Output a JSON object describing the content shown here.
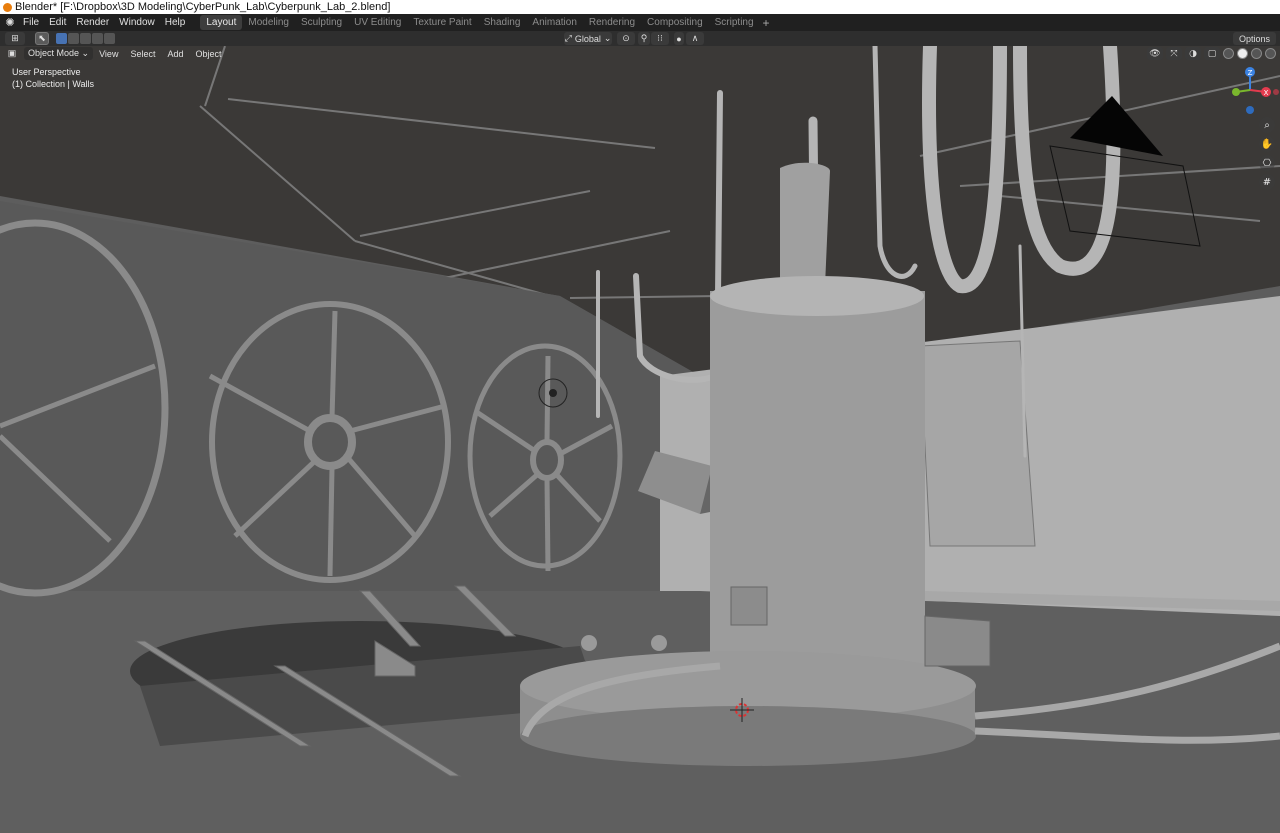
{
  "window": {
    "title": "Blender* [F:\\Dropbox\\3D Modeling\\CyberPunk_Lab\\Cyberpunk_Lab_2.blend]"
  },
  "menu": {
    "items": [
      "File",
      "Edit",
      "Render",
      "Window",
      "Help"
    ]
  },
  "workspaces": {
    "tabs": [
      "Layout",
      "Modeling",
      "Sculpting",
      "UV Editing",
      "Texture Paint",
      "Shading",
      "Animation",
      "Rendering",
      "Compositing",
      "Scripting"
    ],
    "active": "Layout",
    "add_label": "+"
  },
  "header": {
    "transform_orientation": "Global",
    "options_label": "Options"
  },
  "viewport_menu": {
    "mode": "Object Mode",
    "items": [
      "View",
      "Select",
      "Add",
      "Object"
    ]
  },
  "overlay": {
    "perspective": "User Perspective",
    "collection": "(1) Collection | Walls"
  },
  "gizmo": {
    "z_label": "Z",
    "x_label": "X",
    "y_label": "Y",
    "x_color": "#e33b4e",
    "y_color": "#7ab72d",
    "z_color": "#3b83e3"
  },
  "icons": {
    "zoom": "magnifier-icon",
    "pan": "hand-icon",
    "camera": "camera-icon",
    "grid": "grid-icon"
  }
}
